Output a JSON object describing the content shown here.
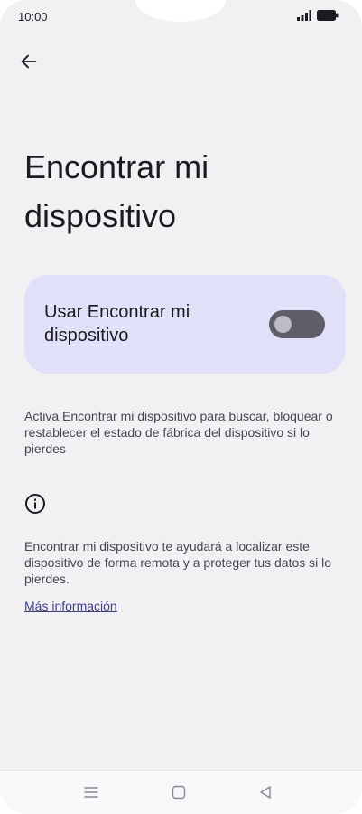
{
  "status_bar": {
    "time": "10:00"
  },
  "header": {
    "back_icon": "arrow-left-icon"
  },
  "page": {
    "title": "Encontrar mi dispositivo"
  },
  "toggle": {
    "label": "Usar Encontrar mi dispositivo",
    "state": "off"
  },
  "description": "Activa Encontrar mi dispositivo para buscar, bloquear o restablecer el estado de fábrica del dispositivo si lo pierdes",
  "info": {
    "icon": "info-icon",
    "text": "Encontrar mi dispositivo te ayudará a localizar este dispositivo de forma remota y a proteger tus datos si lo pierdes.",
    "link": "Más información"
  },
  "colors": {
    "background": "#f3f0f4",
    "card": "#e1e0f9",
    "switch_track": "#5f5e68",
    "link": "#3e4383"
  }
}
